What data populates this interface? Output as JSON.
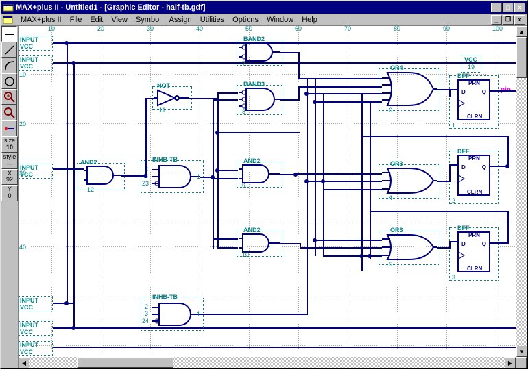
{
  "title": "MAX+plus II - Untitled1 - [Graphic Editor - half-tb.gdf]",
  "menu": [
    "MAX+plus II",
    "File",
    "Edit",
    "View",
    "Symbol",
    "Assign",
    "Utilities",
    "Options",
    "Window",
    "Help"
  ],
  "tool_size_label": "size",
  "tool_size_value": "10",
  "tool_style_label": "style",
  "tool_x_label": "X",
  "tool_x_value": "92",
  "tool_y_label": "Y",
  "tool_y_value": "0",
  "ruler_h": [
    "10",
    "20",
    "30",
    "40",
    "50",
    "60",
    "70",
    "80",
    "90",
    "100"
  ],
  "ruler_v": [
    "10",
    "20",
    "30",
    "40"
  ],
  "inputs": [
    {
      "label": "INPUT",
      "vcc": "VCC"
    },
    {
      "label": "INPUT",
      "vcc": "VCC"
    },
    {
      "label": "INPUT",
      "vcc": "VCC"
    },
    {
      "label": "INPUT",
      "vcc": "VCC"
    },
    {
      "label": "INPUT",
      "vcc": "VCC"
    },
    {
      "label": "INPUT",
      "vcc": "VCC"
    }
  ],
  "gates": {
    "and2_a": {
      "name": "AND2",
      "pin": "12"
    },
    "not": {
      "name": "NOT",
      "pin": "11"
    },
    "inhb_a": {
      "name": "INHB-TB",
      "p1": "2",
      "p2": "3",
      "p3": "23",
      "out": "1"
    },
    "inhb_b": {
      "name": "INHB-TB",
      "p1": "2",
      "p2": "3",
      "p3": "24",
      "out": "1"
    },
    "band2": {
      "name": "BAND2",
      "pin": "7"
    },
    "band3": {
      "name": "BAND3",
      "pin": "8"
    },
    "and2_b": {
      "name": "AND2",
      "pin": "9"
    },
    "and2_c": {
      "name": "AND2",
      "pin": "10"
    },
    "or4": {
      "name": "OR4",
      "pin": "6"
    },
    "or3_a": {
      "name": "OR3",
      "pin": "4"
    },
    "or3_b": {
      "name": "OR3",
      "pin": "5"
    }
  },
  "vcc_top": {
    "label": "VCC",
    "pin": "19"
  },
  "dff": {
    "name": "DFF",
    "d": "D",
    "q": "Q",
    "prn": "PRN",
    "clrn": "CLRN",
    "pins": [
      "1",
      "2",
      "3"
    ]
  },
  "output_pin": "pin"
}
